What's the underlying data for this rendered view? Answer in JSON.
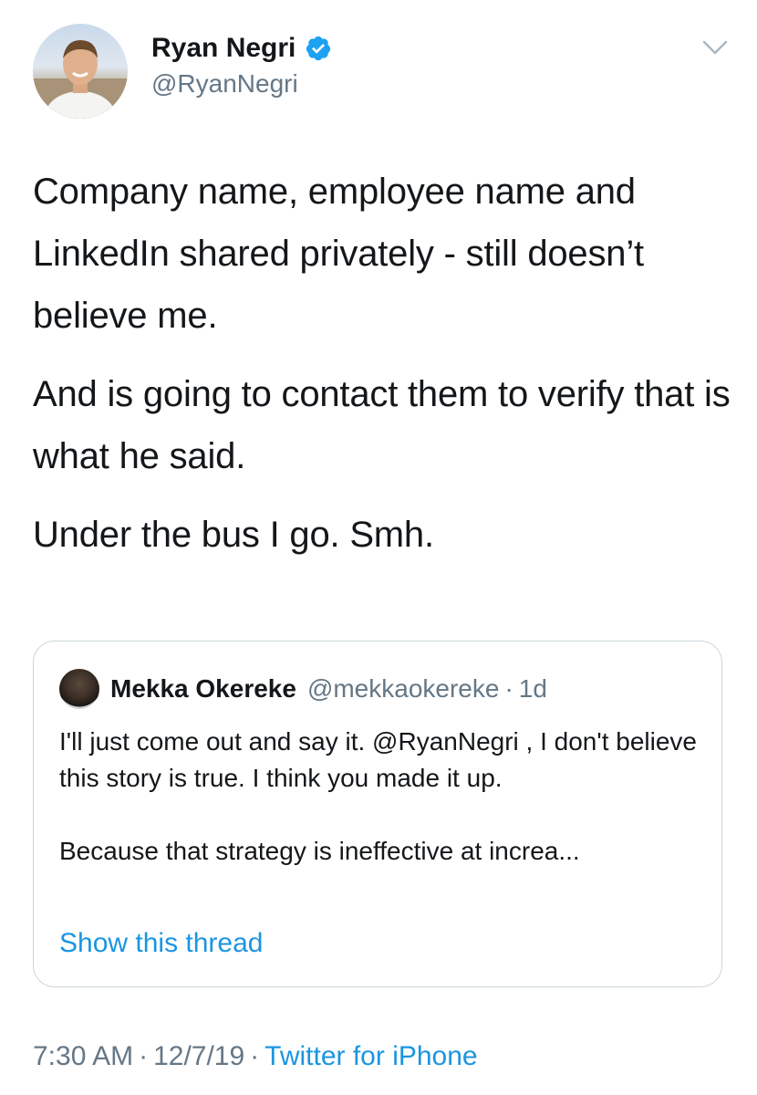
{
  "tweet": {
    "author": {
      "display_name": "Ryan Negri",
      "handle": "@RyanNegri",
      "verified": true,
      "verified_icon": "verified-badge-icon",
      "menu_icon": "chevron-down-icon"
    },
    "paragraphs": [
      "Company name, employee name and LinkedIn shared privately - still doesn’t believe me.",
      "And is going to contact them to verify that is what he said.",
      "Under the bus I go. Smh."
    ],
    "timestamp": "7:30 AM",
    "date": "12/7/19",
    "separator": "·",
    "source": "Twitter for iPhone"
  },
  "quoted_tweet": {
    "display_name": "Mekka Okereke",
    "handle": "@mekkaokereke",
    "separator": "·",
    "age": "1d",
    "text_para1": "I'll just come out and say it. @RyanNegri , I don't believe this story is true. I think you made it up.",
    "text_para2": "Because that strategy is ineffective at increa...",
    "show_thread_label": "Show this thread"
  },
  "colors": {
    "text": "#14171a",
    "secondary": "#657786",
    "link": "#1b95e0",
    "border": "#ccd6dd",
    "verified": "#1da1f2"
  }
}
